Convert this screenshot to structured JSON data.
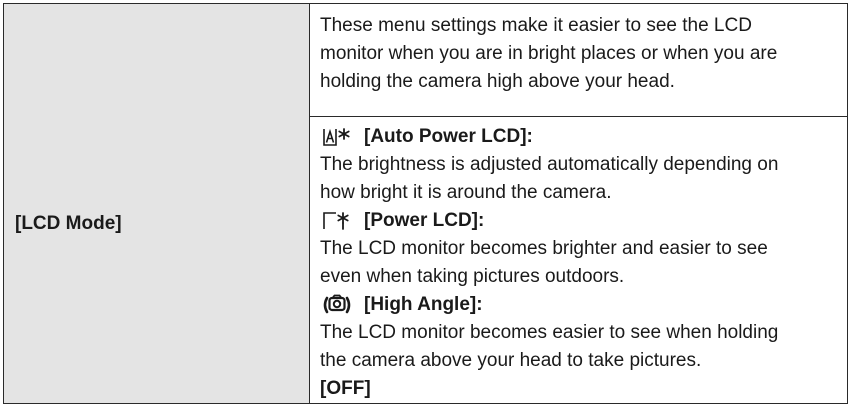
{
  "row": {
    "label": "[LCD Mode]",
    "intro_lines": [
      "These menu settings make it easier to see the LCD",
      "monitor when you are in bright places or when you are",
      "holding the camera high above your head."
    ],
    "options": [
      {
        "icon": "auto-power-lcd-icon",
        "title": "[Auto Power LCD]:",
        "desc_lines": [
          "The brightness is adjusted automatically depending on",
          "how bright it is around the camera."
        ]
      },
      {
        "icon": "power-lcd-icon",
        "title": "[Power LCD]:",
        "desc_lines": [
          "The LCD monitor becomes brighter and easier to see",
          "even when taking pictures outdoors."
        ]
      },
      {
        "icon": "high-angle-icon",
        "title": "[High Angle]:",
        "desc_lines": [
          "The LCD monitor becomes easier to see when holding",
          "the camera above your head to take pictures."
        ]
      }
    ],
    "off_label": "[OFF]"
  }
}
